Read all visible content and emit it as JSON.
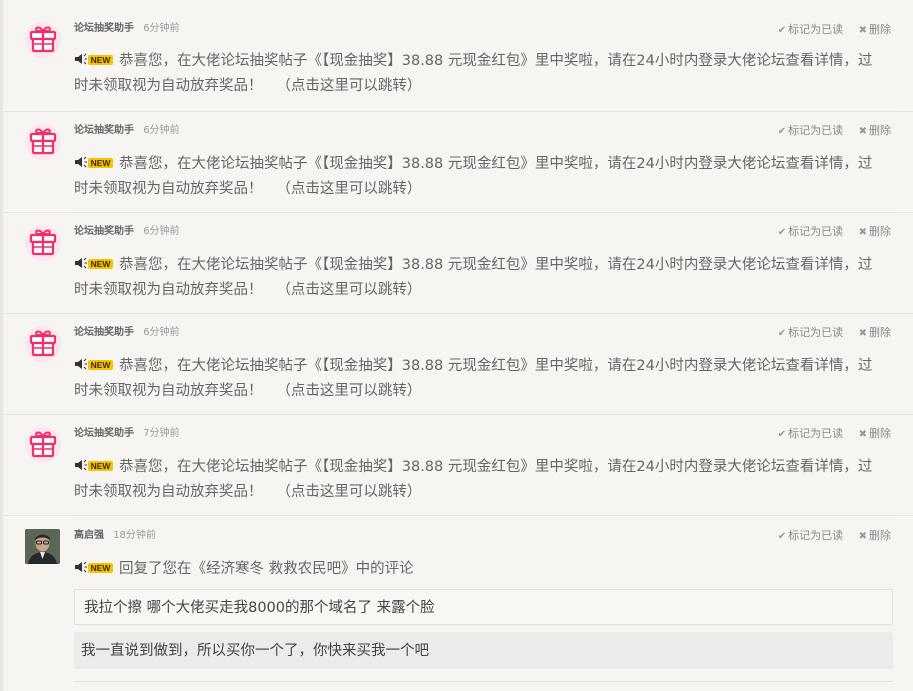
{
  "actions": {
    "mark_read": "标记为已读",
    "delete": "删除"
  },
  "notifications": [
    {
      "author": "论坛抽奖助手",
      "time": "6分钟前",
      "message": "恭喜您，在大佬论坛抽奖帖子《【现金抽奖】38.88 元现金红包》里中奖啦，请在24小时内登录大佬论坛查看详情，过时未领取视为自动放弃奖品！",
      "link": "（点击这里可以跳转）"
    },
    {
      "author": "论坛抽奖助手",
      "time": "6分钟前",
      "message": "恭喜您，在大佬论坛抽奖帖子《【现金抽奖】38.88 元现金红包》里中奖啦，请在24小时内登录大佬论坛查看详情，过时未领取视为自动放弃奖品！",
      "link": "（点击这里可以跳转）"
    },
    {
      "author": "论坛抽奖助手",
      "time": "6分钟前",
      "message": "恭喜您，在大佬论坛抽奖帖子《【现金抽奖】38.88 元现金红包》里中奖啦，请在24小时内登录大佬论坛查看详情，过时未领取视为自动放弃奖品！",
      "link": "（点击这里可以跳转）"
    },
    {
      "author": "论坛抽奖助手",
      "time": "6分钟前",
      "message": "恭喜您，在大佬论坛抽奖帖子《【现金抽奖】38.88 元现金红包》里中奖啦，请在24小时内登录大佬论坛查看详情，过时未领取视为自动放弃奖品！",
      "link": "（点击这里可以跳转）"
    },
    {
      "author": "论坛抽奖助手",
      "time": "7分钟前",
      "message": "恭喜您，在大佬论坛抽奖帖子《【现金抽奖】38.88 元现金红包》里中奖啦，请在24小时内登录大佬论坛查看详情，过时未领取视为自动放弃奖品！",
      "link": "（点击这里可以跳转）"
    }
  ],
  "reply": {
    "author": "高启强",
    "time": "18分钟前",
    "message": "回复了您在《经济寒冬 救救农民吧》中的评论",
    "quoted_comment": "我拉个擦 哪个大佬买走我8000的那个域名了 来露个脸",
    "reply_text": "我一直说到做到，所以买你一个了，你快来买我一个吧"
  },
  "icons": {
    "gift": "gift-icon",
    "new_badge": "speaker-new-icon",
    "check": "check-icon",
    "close": "close-icon"
  },
  "colors": {
    "gift": "#f0306a",
    "new_badge": "#f5c400"
  }
}
